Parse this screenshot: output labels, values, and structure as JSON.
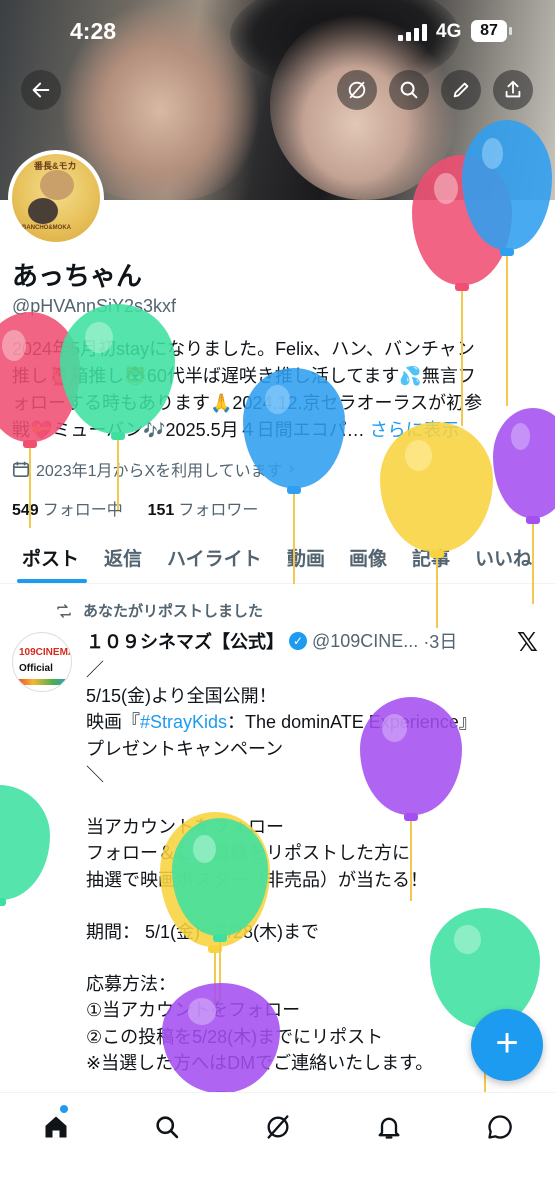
{
  "status_bar": {
    "time": "4:28",
    "network": "4G",
    "battery": "87"
  },
  "header": {
    "back_icon": "arrow-left-icon",
    "actions": [
      "grok-icon",
      "search-icon",
      "edit-icon",
      "share-icon"
    ]
  },
  "profile": {
    "avatar_text_top": "番長&モカ",
    "avatar_text_bottom": "BANCHO&MOKA",
    "name": "あっちゃん",
    "handle": "@pHVAnnSiY2s3kxf",
    "bio_lines": [
      "2024年5月初stayになりました。Felix、ハン、バンチャン",
      "推し🦉箱推し🐯60代半ば遅咲き推し活してます💦無言フ",
      "ォローする時もあります🙏2024.12.京セラオーラスが初参",
      "戦💝ミューバン🎶2025.5月４日間エコパ…"
    ],
    "see_more": "さらに表示",
    "joined": "2023年1月からXを利用しています",
    "following_count": "549",
    "following_label": "フォロー中",
    "followers_count": "151",
    "followers_label": "フォロワー"
  },
  "tabs": [
    "ポスト",
    "返信",
    "ハイライト",
    "動画",
    "画像",
    "記事",
    "いいね"
  ],
  "post": {
    "repost_label": "あなたがリポストしました",
    "avatar_top": "109CINEMAS",
    "avatar_bottom": "Official",
    "author": "１０９シネマズ【公式】",
    "handle": "@109CINE...",
    "time": "·3日",
    "lines": [
      "／",
      "5/15(金)より全国公開！",
      " 映画『",
      " プレゼントキャンペーン",
      "＼",
      "",
      "当アカウントをフォロー",
      "フォロー＆この投稿をリポストした方に",
      " 抽選で映画ポスター（非売品）が当たる！",
      "",
      " 期間： 5/1(金)～5/28(木)まで",
      "",
      " 応募方法：",
      "①当アカウントをフォロー",
      "②この投稿を5/28(木)までにリポスト",
      "※当選した方へはDMでご連絡いたします。"
    ],
    "hashtag": "#StrayKids",
    "film_suffix": "：The dominATE Experience』"
  },
  "fab_label": "+",
  "bottom_nav": [
    "home-icon",
    "search-icon",
    "grok-icon",
    "notifications-icon",
    "messages-icon"
  ],
  "colors": {
    "accent": "#1d9bf0",
    "text": "#0f1419",
    "muted": "#536471"
  }
}
